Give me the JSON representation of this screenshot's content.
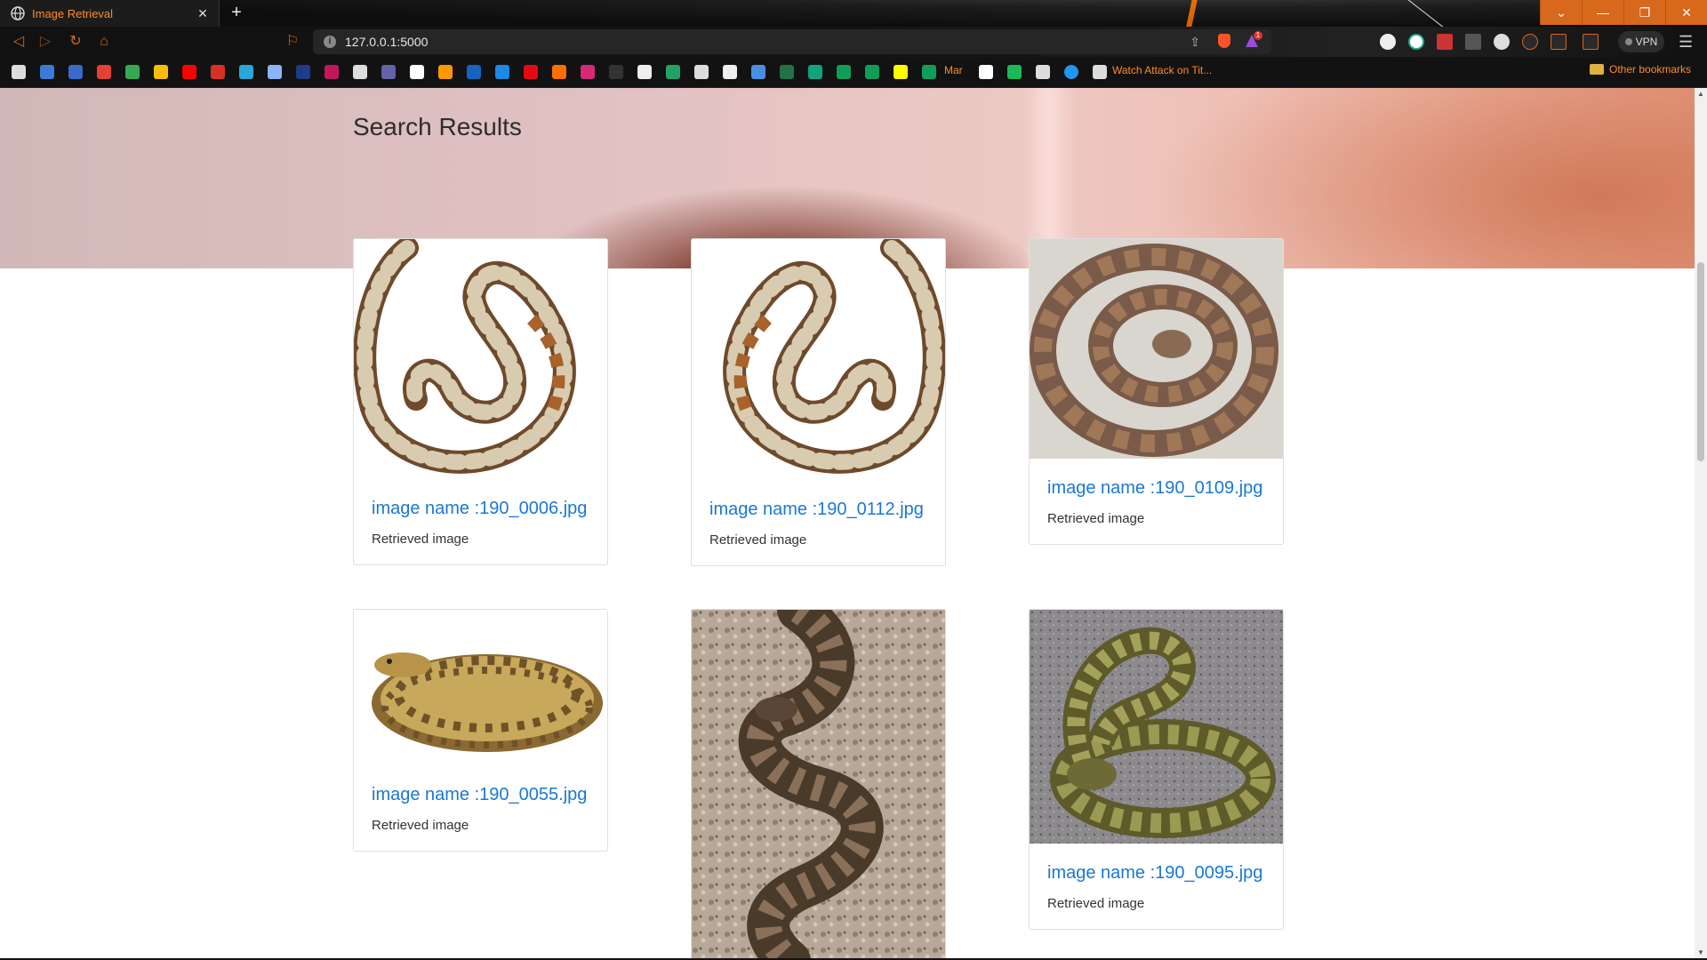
{
  "browser": {
    "tab_title": "Image Retrieval",
    "url": "127.0.0.1:5000",
    "vpn_label": "VPN",
    "rewards_badge": "1",
    "bookmarks": {
      "mar_label": "Mar",
      "watch_label": "Watch Attack on Tit...",
      "other_label": "Other bookmarks"
    }
  },
  "page": {
    "title": "Search Results",
    "results": [
      {
        "name": "image name :190_0006.jpg",
        "desc": "Retrieved image"
      },
      {
        "name": "image name :190_0112.jpg",
        "desc": "Retrieved image"
      },
      {
        "name": "image name :190_0109.jpg",
        "desc": "Retrieved image"
      },
      {
        "name": "image name :190_0055.jpg",
        "desc": "Retrieved image"
      },
      {
        "name": "",
        "desc": ""
      },
      {
        "name": "image name :190_0095.jpg",
        "desc": "Retrieved image"
      }
    ]
  },
  "colors": {
    "accent": "#ff8a2a",
    "link": "#1a78d4",
    "window_controls": "#d7681c"
  }
}
